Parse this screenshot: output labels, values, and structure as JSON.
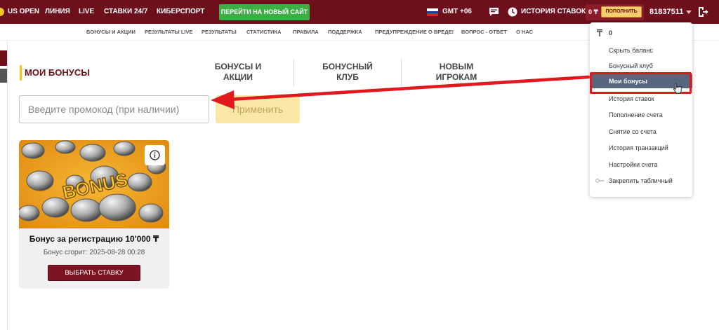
{
  "topnav": {
    "items": [
      "US OPEN",
      "ЛИНИЯ",
      "LIVE",
      "СТАВКИ 24/7",
      "КИБЕРСПОРТ"
    ],
    "new_site_button": "ПЕРЕЙТИ НА НОВЫЙ САЙТ",
    "timezone": "GMT +06",
    "bet_history": "ИСТОРИЯ СТАВОК",
    "balance": "0 ₸",
    "deposit_button": "ПОПОЛНИТЬ",
    "account_id": "81837511"
  },
  "subnav": {
    "items": [
      "БОНУСЫ И АКЦИИ",
      "РЕЗУЛЬТАТЫ LIVE",
      "РЕЗУЛЬТАТЫ",
      "СТАТИСТИКА",
      "ПРАВИЛА",
      "ПОДДЕРЖКА",
      "ПРЕДУПРЕЖДЕНИЕ О ВРЕДЕ!",
      "ВОПРОС - ОТВЕТ",
      "О НАС"
    ]
  },
  "page": {
    "title": "МОИ БОНУСЫ",
    "tabs": [
      {
        "line1": "БОНУСЫ И",
        "line2": "АКЦИИ"
      },
      {
        "line1": "БОНУСНЫЙ",
        "line2": "КЛУБ"
      },
      {
        "line1": "НОВЫМ",
        "line2": "ИГРОКАМ"
      }
    ],
    "promo_placeholder": "Введите промокод (при наличии)",
    "apply_button": "Применить"
  },
  "bonus_card": {
    "image_text": "BONUS",
    "title": "Бонус за регистрацию 10'000 ₸",
    "expires": "Бонус сгорит: 2025-08-28 00:28",
    "button": "ВЫБРАТЬ СТАВКУ"
  },
  "dropdown": {
    "balance": "0",
    "items": [
      "Скрыть баланс",
      "Бонусный клуб",
      "Мои бонусы",
      "История ставок",
      "Пополнение счета",
      "Снятие со счета",
      "История транзакций",
      "Настройки счета",
      "Закрепить табличный"
    ],
    "active_index": 2
  },
  "colors": {
    "brand": "#6e0f1c",
    "accent_yellow": "#f3c623",
    "green": "#3cae44",
    "highlight_red": "#e1181c",
    "active_item": "#56667d"
  }
}
